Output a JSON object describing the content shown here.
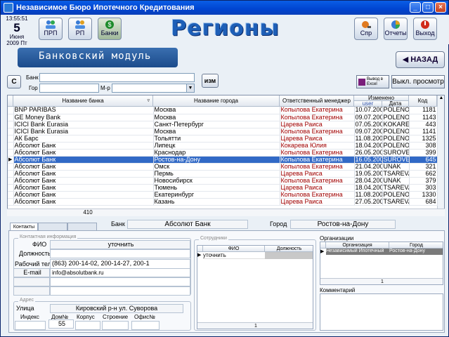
{
  "window": {
    "title": "Независимое Бюро Ипотечного Кредитования"
  },
  "clock": {
    "time": "13:55:51",
    "day": "5",
    "month": "Июня",
    "year_weekday": "2009 Пт"
  },
  "toolbar": {
    "prp": "ПРП",
    "rp": "РП",
    "banks": "Банки",
    "spr": "Спр",
    "reports": "Отчеты",
    "exit": "Выход"
  },
  "header": {
    "title": "Регионы",
    "module": "Банковский модуль",
    "back": "НАЗАД"
  },
  "filters": {
    "clear_label": "С",
    "bank_label": "Банк",
    "city_label": "Гор",
    "mr_label": "М-р",
    "bank_value": "",
    "city_value": "",
    "mr_value": "",
    "change_label": "изм",
    "excel_line1": "Вывод в",
    "excel_line2": "Excel",
    "preview_off": "Выкл. просмотр"
  },
  "grid": {
    "columns": {
      "bank": "Название банка",
      "city": "Название города",
      "manager": "Ответственный менеджер",
      "changed": "Изменено",
      "user": "user",
      "date": "Дата",
      "code": "Код"
    },
    "rows": [
      {
        "bank": "BNP PARIBAS",
        "city": "Москва",
        "manager": "Копылова Екатерина",
        "user": "10.07.200",
        "date": "POLENOV",
        "code": "1181"
      },
      {
        "bank": "GE Money Bank",
        "city": "Москва",
        "manager": "Копылова Екатерина",
        "user": "09.07.200",
        "date": "POLENOV",
        "code": "1143"
      },
      {
        "bank": "ICICI Bank Eurasia",
        "city": "Санкт-Петербург",
        "manager": "Царева Раиса",
        "user": "07.05.200",
        "date": "KOKAREVA",
        "code": "443"
      },
      {
        "bank": "ICICI Bank Eurasia",
        "city": "Москва",
        "manager": "Копылова Екатерина",
        "user": "09.07.200",
        "date": "POLENOV",
        "code": "1141"
      },
      {
        "bank": "АК Барс",
        "city": "Тольятти",
        "manager": "Царева Раиса",
        "user": "11.08.200",
        "date": "POLENOV",
        "code": "1325"
      },
      {
        "bank": "Абсолют Банк",
        "city": "Липецк",
        "manager": "Кокарева Юлия",
        "user": "18.04.200",
        "date": "POLENOV",
        "code": "308"
      },
      {
        "bank": "Абсолют Банк",
        "city": "Краснодар",
        "manager": "Копылова Екатерина",
        "user": "26.05.200",
        "date": "SUROVEN",
        "code": "399"
      },
      {
        "bank": "Абсолют Банк",
        "city": "Ростов-на-Дону",
        "manager": "Копылова Екатерина",
        "user": "16.05.200",
        "date": "SUROVEN",
        "code": "645"
      },
      {
        "bank": "Абсолют Банк",
        "city": "Омск",
        "manager": "Копылова Екатерина",
        "user": "21.04.200",
        "date": "UNAK",
        "code": "321"
      },
      {
        "bank": "Абсолют Банк",
        "city": "Пермь",
        "manager": "Царева Раиса",
        "user": "19.05.200",
        "date": "TSAREVA",
        "code": "662"
      },
      {
        "bank": "Абсолют Банк",
        "city": "Новосибирск",
        "manager": "Копылова Екатерина",
        "user": "28.04.200",
        "date": "UNAK",
        "code": "379"
      },
      {
        "bank": "Абсолют Банк",
        "city": "Тюмень",
        "manager": "Царева Раиса",
        "user": "18.04.200",
        "date": "TSAREVA",
        "code": "303"
      },
      {
        "bank": "Абсолют Банк",
        "city": "Екатеринбург",
        "manager": "Копылова Екатерина",
        "user": "11.08.200",
        "date": "POLENOV",
        "code": "1330"
      },
      {
        "bank": "Абсолют Банк",
        "city": "Казань",
        "manager": "Царева Раиса",
        "user": "27.05.200",
        "date": "TSAREVA",
        "code": "684"
      }
    ],
    "selected_index": 7,
    "count": "410"
  },
  "bottom": {
    "tab_contacts": "Контакты",
    "bank_label": "Банк",
    "bank_value": "Абсолют Банк",
    "city_label": "Город",
    "city_value": "Ростов-на-Дону",
    "contact_group": "Контактная информация",
    "fio_label": "ФИО",
    "fio_value": "уточнить",
    "position_label": "Должность",
    "position_value": "",
    "phone_label": "Рабочий тел.",
    "phone_value": "(863) 200-14-02, 200-14-27, 200-1",
    "email_label": "E-mail",
    "email_value": "info@absolutbank.ru",
    "address_group": "Адрес",
    "street_label": "Улица",
    "street_value": "Кировский р-н ул. Суворова",
    "index_label": "Индекс",
    "index_value": "",
    "house_label": "Дом№",
    "house_value": "55",
    "korpus_label": "Корпус",
    "korpus_value": "",
    "building_label": "Строение",
    "building_value": "",
    "office_label": "Офис№",
    "office_value": "",
    "staff_group": "Сотрудники",
    "staff_fio": "ФИО",
    "staff_position": "Должность",
    "staff_rows": [
      {
        "fio": "уточнить",
        "position": ""
      }
    ],
    "staff_count": "1",
    "orgs_title": "Организации",
    "orgs_col_org": "Организация",
    "orgs_col_city": "Город",
    "orgs_rows": [
      {
        "org": "Независимый Ипотечный",
        "city": "Ростов-на-Дону"
      }
    ],
    "orgs_count": "1",
    "comment_label": "Комментарий"
  }
}
